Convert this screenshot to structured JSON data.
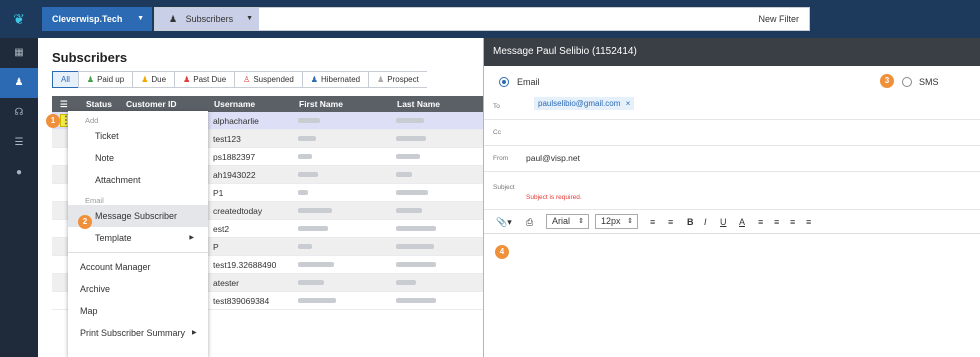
{
  "topbar": {
    "tenant": "Cleverwisp.Tech",
    "scope": "Subscribers",
    "new_filter": "New Filter"
  },
  "main": {
    "title": "Subscribers",
    "tabs": [
      {
        "label": "All",
        "icon": "",
        "color": ""
      },
      {
        "label": "Paid up",
        "icon": "person-icon",
        "color": "#43a047"
      },
      {
        "label": "Due",
        "icon": "person-icon",
        "color": "#f0a800"
      },
      {
        "label": "Past Due",
        "icon": "person-icon",
        "color": "#e53935"
      },
      {
        "label": "Suspended",
        "icon": "person-outline-icon",
        "color": "#e53935"
      },
      {
        "label": "Hibernated",
        "icon": "person-icon",
        "color": "#2c6bb3"
      },
      {
        "label": "Prospect",
        "icon": "person-icon",
        "color": "#aaaaaa"
      }
    ],
    "columns": [
      "Status",
      "Customer ID",
      "Username",
      "First Name",
      "Last Name"
    ],
    "usernames": [
      "alphacharlie",
      "test123",
      "ps1882397",
      "ah1943022",
      "P1",
      "createdtoday",
      "est2",
      "P",
      "test19.32688490",
      "atester",
      "test839069384"
    ]
  },
  "context_menu": {
    "add_header": "Add",
    "ticket": "Ticket",
    "note": "Note",
    "attachment": "Attachment",
    "email_header": "Email",
    "message_subscriber": "Message Subscriber",
    "template": "Template",
    "account_manager": "Account Manager",
    "archive": "Archive",
    "map": "Map",
    "print_summary": "Print Subscriber Summary"
  },
  "message_panel": {
    "title": "Message Paul Selibio (1152414)",
    "email_option": "Email",
    "sms_option": "SMS",
    "to_label": "To",
    "to_value": "paulselibio@gmail.com",
    "chip_remove": "×",
    "cc_label": "Cc",
    "from_label": "From",
    "from_value": "paul@visp.net",
    "subject_label": "Subject",
    "subject_error": "Subject is required.",
    "font_family": "Arial",
    "font_size": "12px",
    "error_color": "#e53935"
  },
  "badges": {
    "one": "1",
    "two": "2",
    "three": "3",
    "four": "4"
  }
}
